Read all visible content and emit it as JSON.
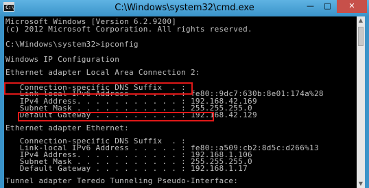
{
  "window": {
    "title": "C:\\Windows\\system32\\cmd.exe",
    "icon_text": "C:\\",
    "buttons": {
      "minimize": "—",
      "maximize": "□",
      "close": "✕"
    }
  },
  "console": {
    "lines": [
      "Microsoft Windows [Version 6.2.9200]",
      "(c) 2012 Microsoft Corporation. All rights reserved.",
      "",
      "C:\\Windows\\system32>ipconfig",
      "",
      "Windows IP Configuration",
      "",
      "",
      "Ethernet adapter Local Area Connection 2:",
      "",
      "   Connection-specific DNS Suffix  . :",
      "   Link-local IPv6 Address . . . . . : fe80::9dc7:630b:8e01:174a%28",
      "   IPv4 Address. . . . . . . . . . . : 192.168.42.169",
      "   Subnet Mask . . . . . . . . . . . : 255.255.255.0",
      "   Default Gateway . . . . . . . . . : 192.168.42.129",
      "",
      "Ethernet adapter Ethernet:",
      "",
      "   Connection-specific DNS Suffix  . :",
      "   Link-local IPv6 Address . . . . . : fe80::a509:cb2:8d5c:d266%13",
      "   IPv4 Address. . . . . . . . . . . : 192.168.1.106",
      "   Subnet Mask . . . . . . . . . . . : 255.255.255.0",
      "   Default Gateway . . . . . . . . . : 192.168.1.17",
      "",
      "Tunnel adapter Teredo Tunneling Pseudo-Interface:"
    ]
  },
  "scrollbar": {
    "up_arrow": "▲",
    "down_arrow": "▼"
  },
  "colors": {
    "console_background": "#000000",
    "console_text": "#c0c0c0",
    "highlight_border": "#e01818",
    "titlebar": "#3a93c9",
    "close_button": "#c7504a"
  }
}
